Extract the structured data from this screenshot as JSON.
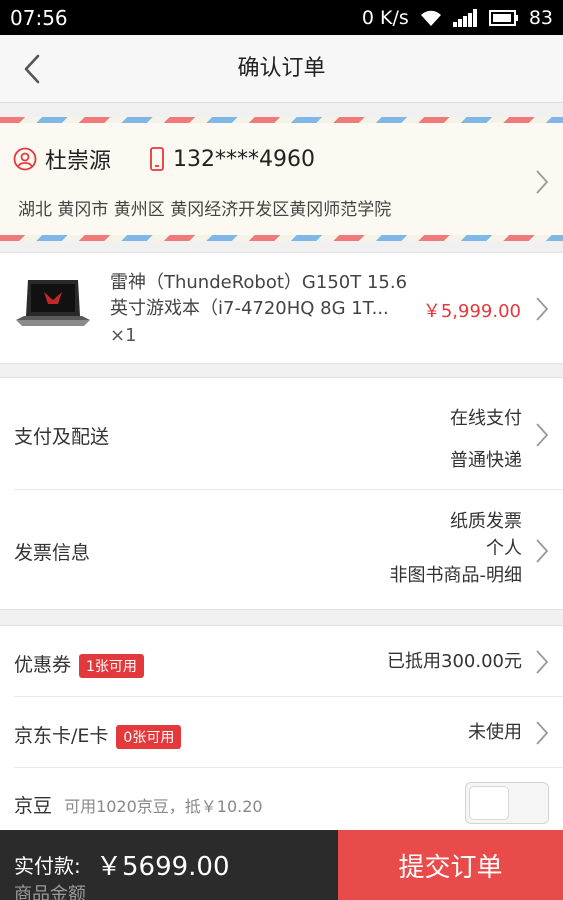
{
  "status": {
    "time": "07:56",
    "net_speed": "0 K/s",
    "battery": "83"
  },
  "header": {
    "title": "确认订单"
  },
  "address": {
    "name": "杜崇源",
    "phone": "132****4960",
    "detail": "湖北 黄冈市 黄州区 黄冈经济开发区黄冈师范学院"
  },
  "product": {
    "name": "雷神（ThundeRobot）G150T 15.6英寸游戏本（i7-4720HQ 8G 1T...",
    "qty": "×1",
    "price": "￥5,999.00"
  },
  "payment": {
    "label": "支付及配送",
    "method": "在线支付",
    "delivery": "普通快递"
  },
  "invoice": {
    "label": "发票信息",
    "type": "纸质发票",
    "title": "个人",
    "content": "非图书商品-明细"
  },
  "coupon": {
    "label": "优惠券",
    "badge": "1张可用",
    "value": "已抵用300.00元"
  },
  "jdcard": {
    "label": "京东卡/E卡",
    "badge": "0张可用",
    "value": "未使用"
  },
  "jingdou": {
    "label": "京豆",
    "desc": "可用1020京豆，抵￥10.20",
    "enabled": false
  },
  "footer": {
    "pay_label": "实付款:",
    "amount": "￥5699.00",
    "submit_label": "提交订单",
    "peek_label": "商品金额"
  }
}
